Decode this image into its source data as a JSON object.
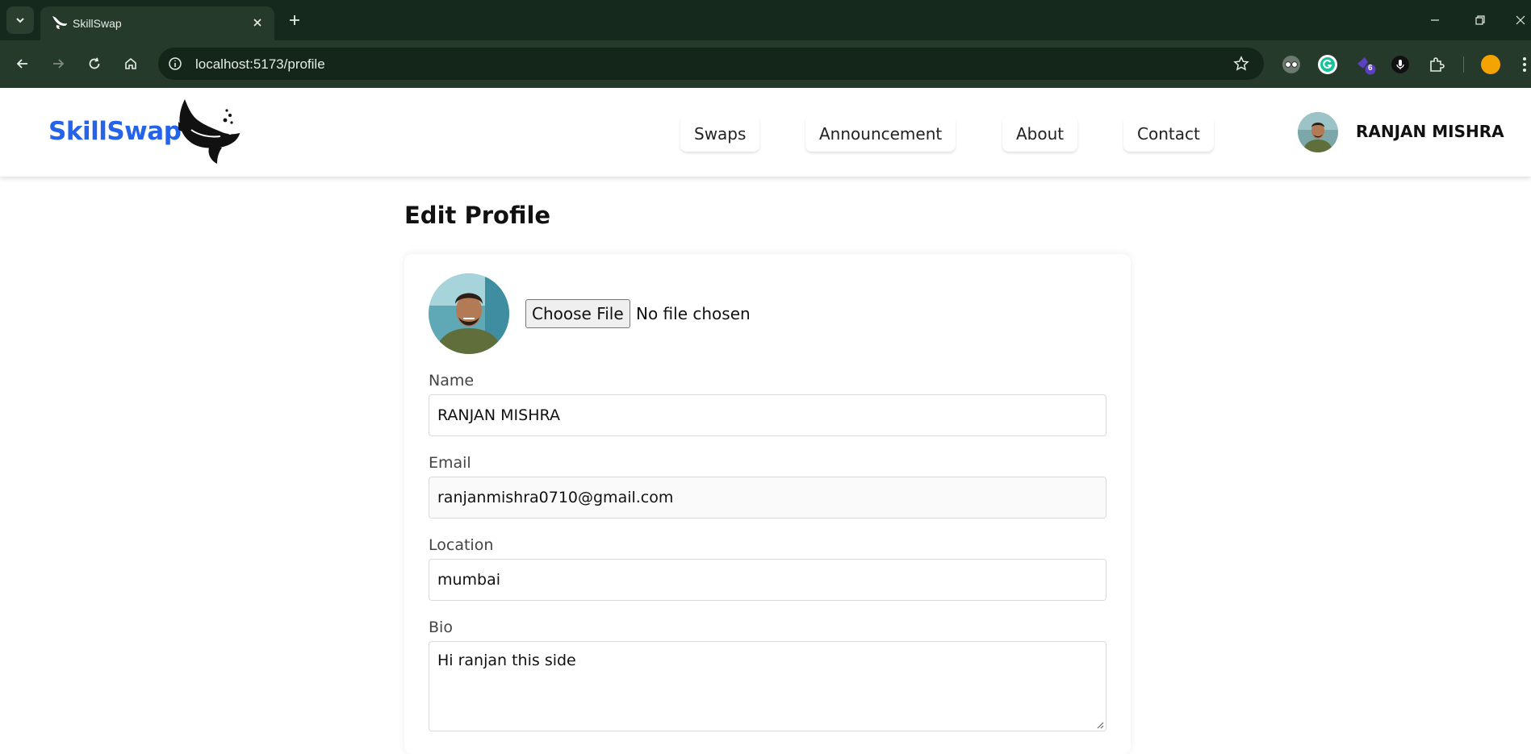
{
  "browser": {
    "tab_title": "SkillSwap",
    "url": "localhost:5173/profile",
    "extension_badge": "6",
    "profile_color": "#f4a300"
  },
  "header": {
    "brand": "SkillSwap",
    "brand_color": "#2563eb",
    "nav": [
      {
        "label": "Swaps"
      },
      {
        "label": "Announcement"
      },
      {
        "label": "About"
      },
      {
        "label": "Contact"
      }
    ],
    "user_name": "RANJAN MISHRA"
  },
  "main": {
    "title": "Edit Profile",
    "file_input": {
      "button_label": "Choose File",
      "status": "No file chosen"
    },
    "fields": {
      "name": {
        "label": "Name",
        "value": "RANJAN MISHRA"
      },
      "email": {
        "label": "Email",
        "value": "ranjanmishra0710@gmail.com"
      },
      "location": {
        "label": "Location",
        "value": "mumbai"
      },
      "bio": {
        "label": "Bio",
        "value": "Hi ranjan this side"
      }
    }
  }
}
